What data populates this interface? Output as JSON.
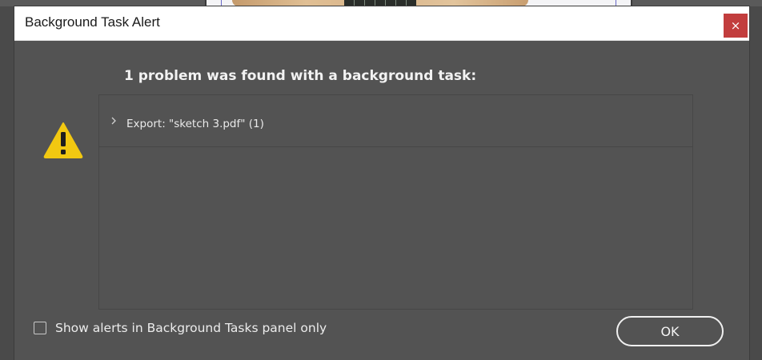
{
  "window": {
    "title": "Background Task Alert",
    "close_glyph": "×"
  },
  "alert": {
    "icon": "warning-icon",
    "headline": "1 problem was found with a background task:",
    "problems": [
      {
        "label": "Export: \"sketch 3.pdf\" (1)",
        "expanded": false
      }
    ]
  },
  "options": {
    "show_in_panel_only": {
      "label": "Show alerts in Background Tasks panel only",
      "checked": false
    }
  },
  "buttons": {
    "ok_label": "OK"
  },
  "colors": {
    "dialog_bg": "#535353",
    "titlebar_bg": "#ffffff",
    "close_bg": "#c23d3d",
    "warning_yellow": "#f2c811"
  }
}
